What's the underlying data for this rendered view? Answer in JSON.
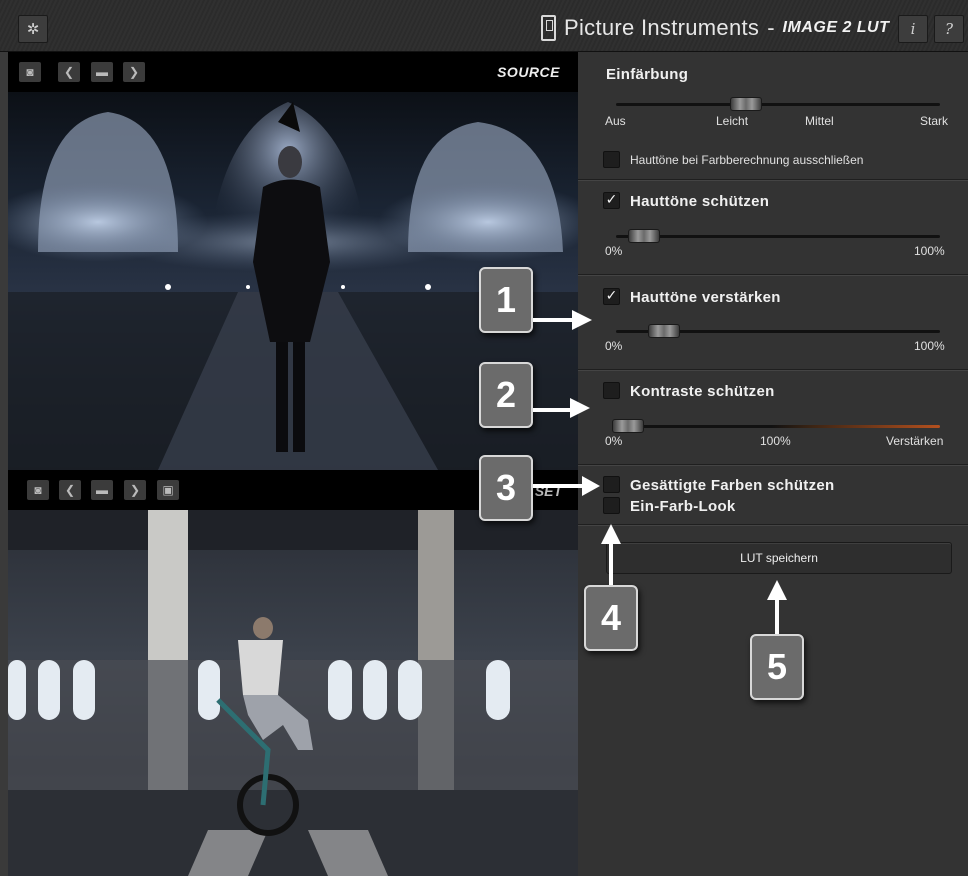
{
  "titlebar": {
    "gear_icon": "gear-icon",
    "brand_name": "Picture Instruments",
    "brand_separator": "-",
    "product_name": "IMAGE 2 LUT",
    "info_label": "i",
    "help_label": "?"
  },
  "source": {
    "label": "SOURCE"
  },
  "target": {
    "label": "SET"
  },
  "panel": {
    "einfaerbung": {
      "title": "Einfärbung",
      "ticks": [
        "Aus",
        "Leicht",
        "Mittel",
        "Stark"
      ],
      "level": 0.42,
      "exclude_checkbox_label": "Hauttöne bei Farbberechnung ausschließen",
      "exclude_checked": false
    },
    "skin_protect": {
      "title": "Hauttöne schützen",
      "checked": true,
      "min_label": "0%",
      "max_label": "100%",
      "level": 0.08
    },
    "skin_enhance": {
      "title": "Hauttöne verstärken",
      "checked": true,
      "min_label": "0%",
      "max_label": "100%",
      "level": 0.14
    },
    "contrast_protect": {
      "title": "Kontraste schützen",
      "checked": false,
      "min_label": "0%",
      "mid_label": "100%",
      "max_label": "Verstärken",
      "level": 0.04
    },
    "saturated_protect": {
      "title": "Gesättigte Farben schützen",
      "checked": false
    },
    "mono_look": {
      "title": "Ein-Farb-Look",
      "checked": false
    },
    "save_button_label": "LUT speichern"
  },
  "callouts": [
    "1",
    "2",
    "3",
    "4",
    "5"
  ],
  "colors": {
    "panel_bg": "#333333",
    "callout_bg": "#6b6b6b",
    "accent_orange": "#b4501e"
  }
}
